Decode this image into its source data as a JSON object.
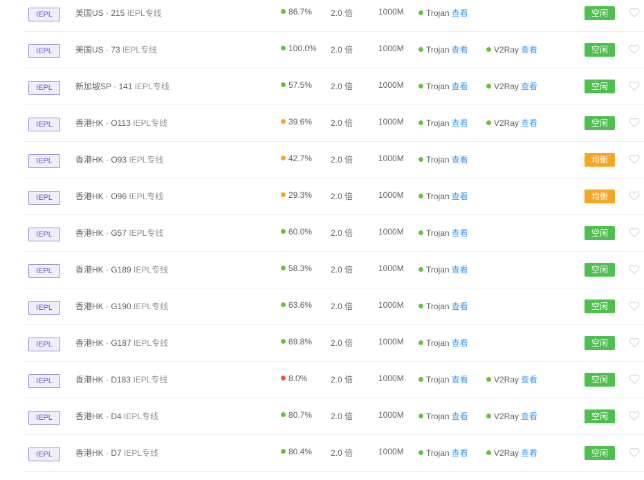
{
  "colors": {
    "green": "#67c23a",
    "orange": "#f5a623",
    "red": "#f04f3e",
    "link": "#409eff",
    "tag_border": "#9b8fd6",
    "status_idle": "#4fc04f",
    "status_balanced": "#f5a623"
  },
  "labels": {
    "view": "查看"
  },
  "rows": [
    {
      "tag": "IEPL",
      "name": "美国US · 215",
      "line": "IEPL专线",
      "rate": "86.7%",
      "rate_color": "green",
      "mult": "2.0 倍",
      "bw": "1000M",
      "proto1": "Trojan",
      "proto2": "",
      "status": "空闲",
      "status_type": "idle"
    },
    {
      "tag": "IEPL",
      "name": "美国US · 73",
      "line": "IEPL专线",
      "rate": "100.0%",
      "rate_color": "green",
      "mult": "2.0 倍",
      "bw": "1000M",
      "proto1": "Trojan",
      "proto2": "V2Ray",
      "status": "空闲",
      "status_type": "idle"
    },
    {
      "tag": "IEPL",
      "name": "新加坡SP · 141",
      "line": "IEPL专线",
      "rate": "57.5%",
      "rate_color": "green",
      "mult": "2.0 倍",
      "bw": "1000M",
      "proto1": "Trojan",
      "proto2": "V2Ray",
      "status": "空闲",
      "status_type": "idle"
    },
    {
      "tag": "IEPL",
      "name": "香港HK · O113",
      "line": "IEPL专线",
      "rate": "39.6%",
      "rate_color": "orange",
      "mult": "2.0 倍",
      "bw": "1000M",
      "proto1": "Trojan",
      "proto2": "V2Ray",
      "status": "空闲",
      "status_type": "idle"
    },
    {
      "tag": "IEPL",
      "name": "香港HK · O93",
      "line": "IEPL专线",
      "rate": "42.7%",
      "rate_color": "orange",
      "mult": "2.0 倍",
      "bw": "1000M",
      "proto1": "Trojan",
      "proto2": "",
      "status": "均衡",
      "status_type": "balanced"
    },
    {
      "tag": "IEPL",
      "name": "香港HK · O96",
      "line": "IEPL专线",
      "rate": "29.3%",
      "rate_color": "orange",
      "mult": "2.0 倍",
      "bw": "1000M",
      "proto1": "Trojan",
      "proto2": "",
      "status": "均衡",
      "status_type": "balanced"
    },
    {
      "tag": "IEPL",
      "name": "香港HK · G57",
      "line": "IEPL专线",
      "rate": "60.0%",
      "rate_color": "green",
      "mult": "2.0 倍",
      "bw": "1000M",
      "proto1": "Trojan",
      "proto2": "",
      "status": "空闲",
      "status_type": "idle"
    },
    {
      "tag": "IEPL",
      "name": "香港HK · G189",
      "line": "IEPL专线",
      "rate": "58.3%",
      "rate_color": "green",
      "mult": "2.0 倍",
      "bw": "1000M",
      "proto1": "Trojan",
      "proto2": "",
      "status": "空闲",
      "status_type": "idle"
    },
    {
      "tag": "IEPL",
      "name": "香港HK · G190",
      "line": "IEPL专线",
      "rate": "63.6%",
      "rate_color": "green",
      "mult": "2.0 倍",
      "bw": "1000M",
      "proto1": "Trojan",
      "proto2": "",
      "status": "空闲",
      "status_type": "idle"
    },
    {
      "tag": "IEPL",
      "name": "香港HK · G187",
      "line": "IEPL专线",
      "rate": "69.8%",
      "rate_color": "green",
      "mult": "2.0 倍",
      "bw": "1000M",
      "proto1": "Trojan",
      "proto2": "",
      "status": "空闲",
      "status_type": "idle"
    },
    {
      "tag": "IEPL",
      "name": "香港HK · D183",
      "line": "IEPL专线",
      "rate": "8.0%",
      "rate_color": "red",
      "mult": "2.0 倍",
      "bw": "1000M",
      "proto1": "Trojan",
      "proto2": "V2Ray",
      "status": "空闲",
      "status_type": "idle"
    },
    {
      "tag": "IEPL",
      "name": "香港HK · D4",
      "line": "IEPL专线",
      "rate": "80.7%",
      "rate_color": "green",
      "mult": "2.0 倍",
      "bw": "1000M",
      "proto1": "Trojan",
      "proto2": "V2Ray",
      "status": "空闲",
      "status_type": "idle"
    },
    {
      "tag": "IEPL",
      "name": "香港HK · D7",
      "line": "IEPL专线",
      "rate": "80.4%",
      "rate_color": "green",
      "mult": "2.0 倍",
      "bw": "1000M",
      "proto1": "Trojan",
      "proto2": "V2Ray",
      "status": "空闲",
      "status_type": "idle"
    }
  ]
}
